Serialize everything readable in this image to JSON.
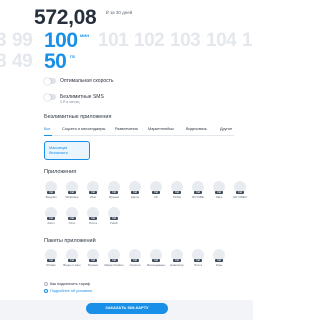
{
  "price": {
    "amount": "572,08",
    "note": "₽ за 30 дней"
  },
  "minutes_picker": {
    "values": [
      "99",
      "100",
      "101",
      "102",
      "103",
      "104",
      "1"
    ],
    "left_partial": "3",
    "selected": "100",
    "unit": "МИН"
  },
  "gb_picker": {
    "values": [
      "49",
      "50"
    ],
    "left_partial": "8",
    "selected": "50",
    "unit": "ГБ"
  },
  "toggles": [
    {
      "label": "Оптимальная скорость",
      "sub": ""
    },
    {
      "label": "Безлимитные SMS",
      "sub": "0 ₽ в месяц"
    }
  ],
  "unlimited_apps": {
    "title": "Безлимитные приложения",
    "tabs": [
      "Все",
      "Соцсети и мессенджеры",
      "Развлечения",
      "Маркетплейсы",
      "Видеосвязь",
      "Другое"
    ],
    "active_tab": "Все",
    "card_lines": [
      "Максимум",
      "безлимита"
    ]
  },
  "apps_section": {
    "title": "Приложения",
    "apps": [
      {
        "name": "Telegram",
        "price": "0 ₽"
      },
      {
        "name": "WhatsApp",
        "price": "0 ₽"
      },
      {
        "name": "Viber",
        "price": "0 ₽"
      },
      {
        "name": "Музыка",
        "price": "0 ₽"
      },
      {
        "name": "Карты",
        "price": "0 ₽"
      },
      {
        "name": "VK",
        "price": "0 ₽"
      },
      {
        "name": "TikTok",
        "price": "0 ₽"
      },
      {
        "name": "RUTUBE",
        "price": "0 ₽"
      },
      {
        "name": "Okko",
        "price": "0 ₽"
      },
      {
        "name": "HD VIDEO",
        "price": "0 ₽"
      },
      {
        "name": "Zoom",
        "price": "0 ₽"
      },
      {
        "name": "Ozon",
        "price": "0 ₽"
      },
      {
        "name": "Почта",
        "price": "0 ₽"
      },
      {
        "name": "Twitch",
        "price": "0 ₽"
      }
    ]
  },
  "packs_section": {
    "title": "Пакеты приложений",
    "packs": [
      {
        "name": "Облако",
        "price": "0 ₽"
      },
      {
        "name": "Видео и кино",
        "price": "0 ₽"
      },
      {
        "name": "Музыка",
        "price": "0 ₽"
      },
      {
        "name": "Маркетплейсы",
        "price": "0 ₽"
      },
      {
        "name": "Соцсети",
        "price": "0 ₽"
      },
      {
        "name": "Мессенджеры",
        "price": "0 ₽"
      },
      {
        "name": "Навигатор",
        "price": "0 ₽"
      },
      {
        "name": "Почта",
        "price": "0 ₽"
      },
      {
        "name": "Игры",
        "price": "0 ₽"
      }
    ]
  },
  "links": {
    "how_it_works": "Как подключить тариф",
    "terms": "Подробнее об условиях"
  },
  "cta": {
    "label": "ЗАКАЗАТЬ SIM-КАРТУ"
  },
  "colors": {
    "accent": "#1990e8",
    "text": "#2b3440",
    "muted_number": "#e4e8ed"
  }
}
